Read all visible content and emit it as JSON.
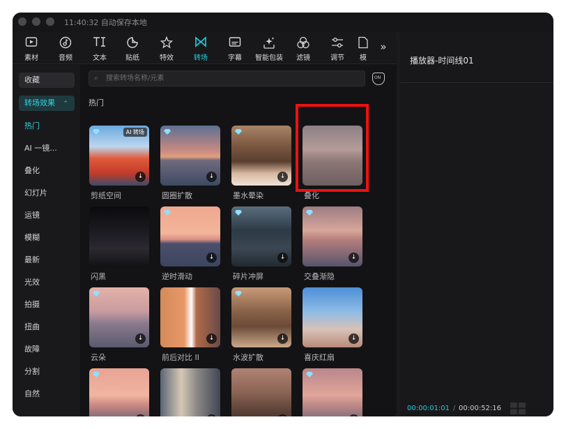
{
  "window": {
    "title": "11:40:32 自动保存本地"
  },
  "toolbar": {
    "items": [
      {
        "label": "素材",
        "icon": "media-icon"
      },
      {
        "label": "音频",
        "icon": "audio-icon"
      },
      {
        "label": "文本",
        "icon": "text-icon"
      },
      {
        "label": "贴纸",
        "icon": "sticker-icon"
      },
      {
        "label": "特效",
        "icon": "effects-icon"
      },
      {
        "label": "转场",
        "icon": "transition-icon",
        "active": true
      },
      {
        "label": "字幕",
        "icon": "caption-icon"
      },
      {
        "label": "智能包装",
        "icon": "smart-pack-icon"
      },
      {
        "label": "滤镜",
        "icon": "filter-icon"
      },
      {
        "label": "调节",
        "icon": "adjust-icon"
      },
      {
        "label": "模",
        "icon": "template-icon"
      }
    ],
    "more": "»"
  },
  "sidebar": {
    "favorites": "收藏",
    "category": "转场效果",
    "category_caret": "⌃",
    "items": [
      "热门",
      "AI 一镜...",
      "叠化",
      "幻灯片",
      "运镜",
      "模糊",
      "最新",
      "光效",
      "拍摄",
      "扭曲",
      "故障",
      "分割",
      "自然"
    ]
  },
  "search": {
    "placeholder": "搜索转场名称/元素"
  },
  "filter_button": {
    "icon": "filter-shield-icon",
    "text": "ON"
  },
  "section": {
    "title": "热门"
  },
  "cards": [
    {
      "label": "剪纸空间",
      "badge": "AI 转场"
    },
    {
      "label": "圆圈扩散"
    },
    {
      "label": "墨水晕染"
    },
    {
      "label": "叠化"
    },
    {
      "label": "闪黑"
    },
    {
      "label": "逆时滑动"
    },
    {
      "label": "碎片冲屏"
    },
    {
      "label": "交叠渐隐"
    },
    {
      "label": "云朵"
    },
    {
      "label": "前后对比 II"
    },
    {
      "label": "水波扩散"
    },
    {
      "label": "喜庆红扇"
    },
    {
      "label": ""
    },
    {
      "label": ""
    },
    {
      "label": ""
    },
    {
      "label": ""
    }
  ],
  "download_glyph": "↓",
  "player": {
    "title": "播放器-时间线01",
    "current": "00:00:01:01",
    "separator": "/",
    "total": "00:00:52:16"
  },
  "colors": {
    "accent": "#20d2e0",
    "highlight": "#ee1111"
  }
}
